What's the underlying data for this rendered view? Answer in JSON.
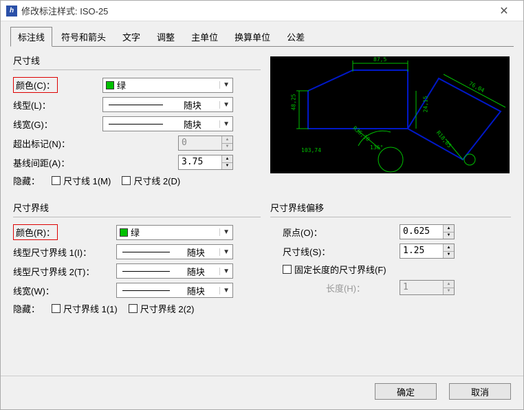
{
  "window_title": "修改标注样式: ISO-25",
  "tabs": {
    "items": [
      "标注线",
      "符号和箭头",
      "文字",
      "调整",
      "主单位",
      "换算单位",
      "公差"
    ],
    "active_index": 0
  },
  "dim_line": {
    "title": "尺寸线",
    "color_label": "颜色(C)：",
    "color_value": "绿",
    "color_hex": "#00c000",
    "linetype_label": "线型(L)：",
    "linetype_value": "随块",
    "lineweight_label": "线宽(G)：",
    "lineweight_value": "随块",
    "extend_label": "超出标记(N)：",
    "extend_value": "0",
    "baseline_label": "基线间距(A)：",
    "baseline_value": "3.75",
    "hide_label": "隐藏：",
    "hide1_label": "尺寸线 1(M)",
    "hide2_label": "尺寸线 2(D)"
  },
  "preview": {
    "top_dim": "87,5",
    "left_dim": "48,25",
    "mid_dim": "24,15",
    "slant_dim": "76,04",
    "rad_dim": "R36,10",
    "angle_dim": "136°",
    "r2_dim": "R18,05",
    "coord_dim": "103,74"
  },
  "ext_line": {
    "title": "尺寸界线",
    "color_label": "颜色(R)：",
    "color_value": "绿",
    "color_hex": "#00c000",
    "lt1_label": "线型尺寸界线 1(I)：",
    "lt1_value": "随块",
    "lt2_label": "线型尺寸界线 2(T)：",
    "lt2_value": "随块",
    "lw_label": "线宽(W)：",
    "lw_value": "随块",
    "hide_label": "隐藏：",
    "hide1_label": "尺寸界线 1(1)",
    "hide2_label": "尺寸界线 2(2)"
  },
  "offset": {
    "title": "尺寸界线偏移",
    "origin_label": "原点(O)：",
    "origin_value": "0.625",
    "dimline_label": "尺寸线(S)：",
    "dimline_value": "1.25",
    "fixed_label": "固定长度的尺寸界线(F)",
    "length_label": "长度(H)：",
    "length_value": "1"
  },
  "buttons": {
    "ok": "确定",
    "cancel": "取消"
  }
}
